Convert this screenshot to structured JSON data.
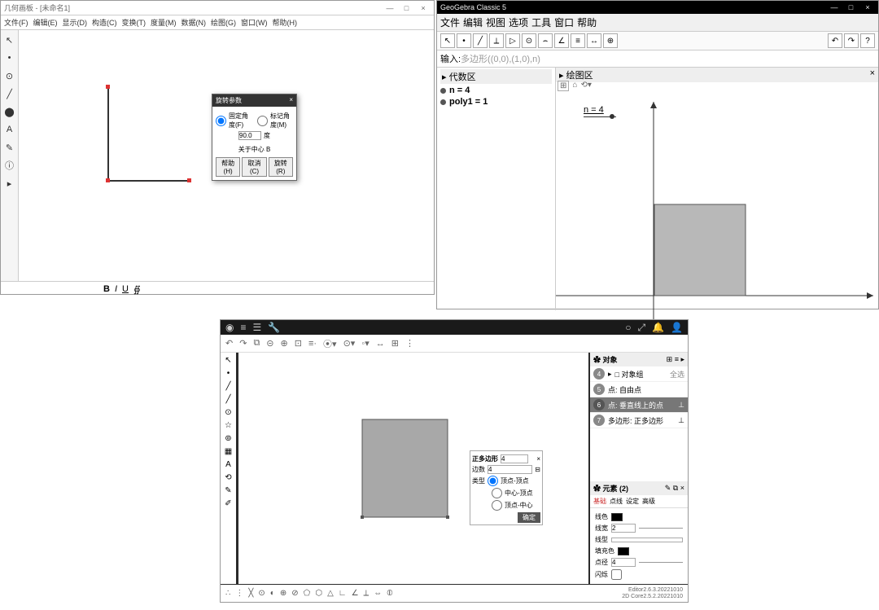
{
  "app1": {
    "title": "几何画板 - [未命名1]",
    "menu": [
      "文件(F)",
      "编辑(E)",
      "显示(D)",
      "构造(C)",
      "变换(T)",
      "度量(M)",
      "数据(N)",
      "绘图(G)",
      "窗口(W)",
      "帮助(H)"
    ],
    "win_btns": {
      "min": "—",
      "max": "□",
      "close": "×"
    },
    "tools": [
      "↖",
      "•",
      "⊙",
      "╱",
      "⬤",
      "A",
      "✎",
      "ⓘ",
      "▸"
    ],
    "dialog": {
      "title": "旋转参数",
      "close": "×",
      "opt1": "固定角度(F)",
      "opt2": "标记角度(M)",
      "val": "90.0",
      "unit": "度",
      "center": "关于中心 B",
      "help": "帮助(H)",
      "cancel": "取消(C)",
      "ok": "旋转(R)"
    },
    "fmt": {
      "b": "B",
      "i": "I",
      "u": "U"
    }
  },
  "app2": {
    "title": "GeoGebra Classic 5",
    "win_btns": {
      "min": "—",
      "max": "□",
      "close": "×"
    },
    "menu": [
      "文件",
      "编辑",
      "视图",
      "选项",
      "工具",
      "窗口",
      "帮助"
    ],
    "tools": [
      "↖",
      "•",
      "╱",
      "⟂",
      "▷",
      "⊙",
      "⌢",
      "∠",
      "≡",
      "↔",
      "⊕"
    ],
    "rtools": [
      "↶",
      "↷",
      "?"
    ],
    "input_label": "输入:",
    "input_text": "多边形((0,0),(1,0),n)",
    "alg_header": "▸ 代数区",
    "graph_header": "▸ 绘图区",
    "graph_close": "×",
    "alg_items": [
      {
        "name": "n = 4"
      },
      {
        "name": "poly1 = 1"
      }
    ],
    "slider_label": "n = 4",
    "subbar_icons": [
      "⌂",
      "⟲▾"
    ]
  },
  "app3": {
    "topleft_icons": [
      "≡",
      "☰",
      "🔧"
    ],
    "topright_icons": [
      "⤢",
      "🔔",
      "👤"
    ],
    "toolbar": [
      "↶",
      "↷",
      "⧉",
      "⊝",
      "⊕",
      "⊡",
      "≡·",
      "⦿▾",
      "⊙▾",
      "◦▾",
      "↔",
      "⊞",
      "⋮"
    ],
    "ltools": [
      "↖",
      "•",
      "╱",
      "╱",
      "⊙",
      "☆",
      "⊚",
      "▦",
      "A",
      "⟲",
      "✎",
      "✐"
    ],
    "dlg": {
      "title": "正多边形",
      "val": "4",
      "close": "×",
      "sides_lbl": "边数",
      "sides_val": "4",
      "type_lbl": "类型",
      "opt1": "顶点-顶点",
      "opt2": "中心-顶点",
      "opt3": "顶点-中心",
      "ok": "确定"
    },
    "objects": {
      "header": "✿ 对象",
      "all": "全选",
      "hdr_icons": [
        "⊞",
        "≡",
        "▸"
      ],
      "rows": [
        {
          "n": "4",
          "t": "□ 对象组",
          "i": ""
        },
        {
          "n": "5",
          "t": "点: 自由点",
          "i": ""
        },
        {
          "n": "6",
          "t": "点: 垂直线上的点",
          "i": "⊥"
        },
        {
          "n": "7",
          "t": "多边形: 正多边形",
          "i": "⊥"
        }
      ]
    },
    "element": {
      "header": "✿ 元素 (2)",
      "hdr_icons": [
        "✎",
        "⧉",
        "×"
      ],
      "tabs": [
        "基础",
        "点线",
        "设定",
        "高级"
      ],
      "props": {
        "color_lbl": "线色",
        "width_lbl": "线宽",
        "width": "2",
        "style_lbl": "线型",
        "fill_lbl": "填充色",
        "psize_lbl": "点径",
        "psize": "4",
        "blink_lbl": "闪烁"
      }
    },
    "bottom_tools": [
      "∴",
      "⋮",
      "╳",
      "⊙",
      "◐",
      "⊕",
      "⊘",
      "⬠",
      "⬡",
      "△",
      "∟",
      "∠",
      "⟂",
      "⇔",
      "⦶"
    ],
    "version": {
      "l1": "Editor2.6.3.20221010",
      "l2": "2D Core2.5.2.20221010"
    }
  }
}
